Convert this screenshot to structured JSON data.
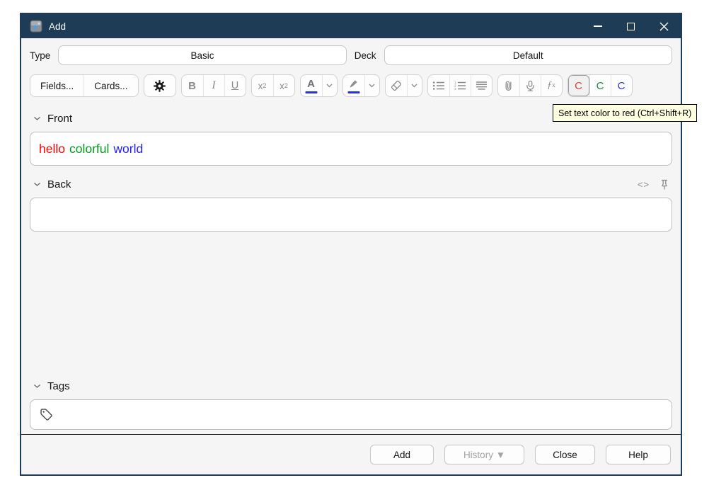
{
  "window": {
    "title": "Add",
    "titlebar_bg": "#1e3c55"
  },
  "type_row": {
    "type_label": "Type",
    "type_value": "Basic",
    "deck_label": "Deck",
    "deck_value": "Default"
  },
  "toolbar": {
    "fields_label": "Fields...",
    "cards_label": "Cards...",
    "bold_label": "B",
    "italic_label": "I",
    "underline_label": "U",
    "sup_base": "x",
    "sup_mark": "2",
    "sub_base": "x",
    "sub_mark": "2",
    "text_color_letter": "A",
    "accent_underline_color": "#2433dd",
    "fx_base": "ƒ",
    "fx_mark": "x",
    "cloze_buttons": [
      {
        "label": "C",
        "color": "#d64537"
      },
      {
        "label": "C",
        "color": "#1f8843"
      },
      {
        "label": "C",
        "color": "#3139cf"
      }
    ]
  },
  "tooltip": {
    "text": "Set text color to red (Ctrl+Shift+R)",
    "bg": "#ffffe1"
  },
  "front": {
    "label": "Front",
    "words": [
      {
        "text": "hello",
        "color": "#ff0000"
      },
      {
        "text": "colorful",
        "color": "#009b1a"
      },
      {
        "text": "world",
        "color": "#2020ff"
      }
    ]
  },
  "back": {
    "label": "Back",
    "code_icon": "<>"
  },
  "tags": {
    "label": "Tags",
    "value": ""
  },
  "footer": {
    "buttons": [
      {
        "label": "Add"
      },
      {
        "label": "History ▼"
      },
      {
        "label": "Close"
      },
      {
        "label": "Help"
      }
    ]
  }
}
